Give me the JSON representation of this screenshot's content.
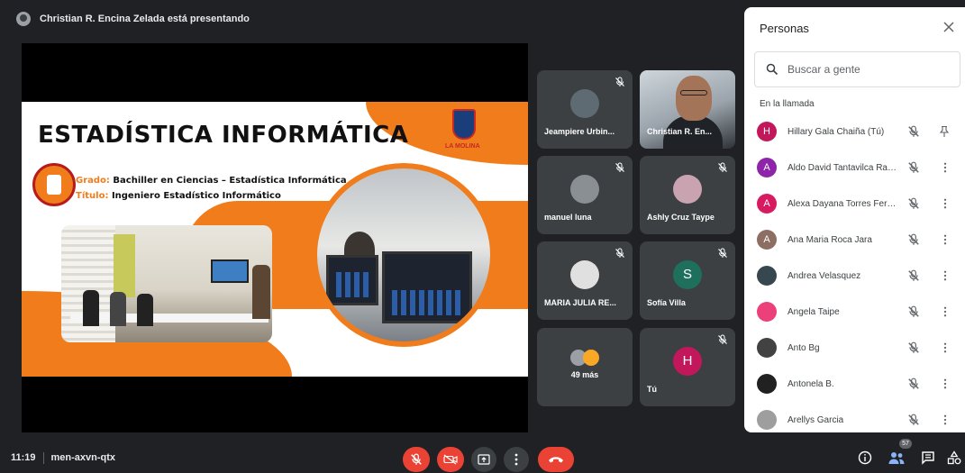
{
  "presenter": {
    "text": "Christian R. Encina Zelada está presentando"
  },
  "slide": {
    "title": "ESTADÍSTICA INFORMÁTICA",
    "university": "LA MOLINA",
    "grado_key": "Grado:",
    "grado_value": "Bachiller en Ciencias – Estadística Informática",
    "titulo_key": "Título:",
    "titulo_value": "Ingeniero Estadístico Informático"
  },
  "tiles": [
    {
      "name": "Jeampiere Urbin...",
      "avatar": "image",
      "muted": true
    },
    {
      "name": "Christian R. En...",
      "avatar": "video",
      "muted": false
    },
    {
      "name": "manuel luna",
      "avatar": "image",
      "muted": true
    },
    {
      "name": "Ashly Cruz Taype",
      "avatar": "blank",
      "muted": true
    },
    {
      "name": "MARIA JULIA RE...",
      "avatar": "image",
      "muted": true
    },
    {
      "name": "Sofía Villa",
      "avatar": "S",
      "muted": true
    },
    {
      "name": "49 más",
      "avatar": "group",
      "muted": false
    },
    {
      "name": "Tú",
      "avatar": "H",
      "muted": true
    }
  ],
  "panel": {
    "title": "Personas",
    "search_placeholder": "Buscar a gente",
    "section": "En la llamada",
    "people": [
      {
        "name": "Hillary Gala Chaiña (Tú)",
        "initial": "H",
        "color": "#c2185b",
        "action": "pin"
      },
      {
        "name": "Aldo David Tantavilca Raz...",
        "initial": "A",
        "color": "#8e24aa",
        "action": "more"
      },
      {
        "name": "Alexa Dayana Torres Fern...",
        "initial": "A",
        "color": "#d81b60",
        "action": "more"
      },
      {
        "name": "Ana Maria Roca Jara",
        "initial": "A",
        "color": "#8d6e63",
        "action": "more"
      },
      {
        "name": "Andrea Velasquez",
        "initial": "",
        "color": "#37474f",
        "action": "more"
      },
      {
        "name": "Angela Taipe",
        "initial": "",
        "color": "#ec407a",
        "action": "more"
      },
      {
        "name": "Anto Bg",
        "initial": "",
        "color": "#424242",
        "action": "more"
      },
      {
        "name": "Antonela B.",
        "initial": "",
        "color": "#212121",
        "action": "more"
      },
      {
        "name": "Arellys Garcia",
        "initial": "",
        "color": "#9e9e9e",
        "action": "more"
      }
    ]
  },
  "bottom": {
    "time": "11:19",
    "meeting_code": "men-axvn-qtx",
    "participant_count": "57"
  },
  "colors": {
    "accent_red": "#ea4335",
    "bar_bg": "#202124",
    "slide_orange": "#f07c1b"
  }
}
